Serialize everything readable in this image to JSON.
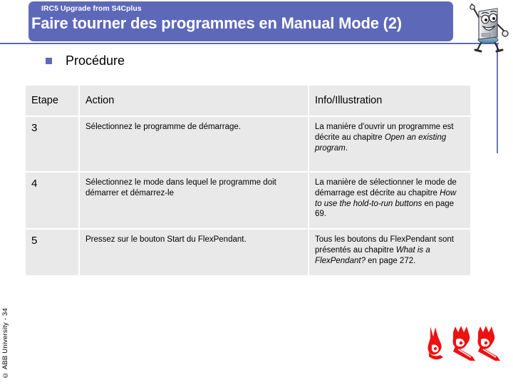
{
  "slide": {
    "subtitle": "IRC5 Upgrade from S4Cplus",
    "title": "Faire tourner des programmes en Manual Mode (2)",
    "bullet_label": "Procédure",
    "copyright": "© ABB University - 34"
  },
  "theme": {
    "header_bg": "#5d69b8",
    "header_text": "#ffffff",
    "rule_color": "#5d69b8",
    "table_cell_bg": "#e9e9e9",
    "logo_red": "#ee1111",
    "bullet_color": "#5d69b8"
  },
  "table": {
    "headers": [
      "Etape",
      "Action",
      "Info/Illustration"
    ],
    "rows": [
      {
        "step": "3",
        "action": "Sélectionnez le programme de démarrage.",
        "info_pre": "La manière d'ouvrir un programme est décrite au chapitre ",
        "info_em": "Open an existing program",
        "info_post": "."
      },
      {
        "step": "4",
        "action": "Sélectionnez le mode dans lequel le programme doit démarrer et démarrez-le",
        "info_pre": "La manière de sélectionner le mode de démarrage est décrite au chapitre ",
        "info_em": "How to use the hold-to-run buttons",
        "info_post": " en page 69."
      },
      {
        "step": "5",
        "action": "Pressez sur le bouton Start du FlexPendant.",
        "info_pre": "Tous les boutons du FlexPendant sont présentés au chapitre ",
        "info_em": "What is a FlexPendant?",
        "info_post": " en page 272."
      }
    ]
  },
  "icons": {
    "bullet": "square-bullet-icon",
    "mascot": "robot-mascot-icon",
    "logo_group": "red-robot-arm-icons"
  }
}
